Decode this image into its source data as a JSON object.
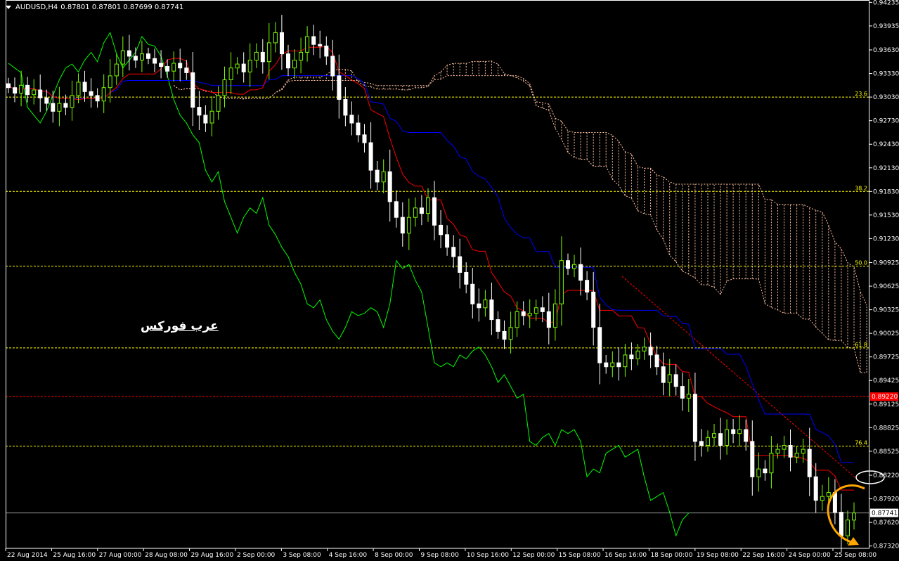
{
  "header": {
    "symbol_label": "AUDUSD,H4",
    "ohlc": "0.87801 0.87801 0.87699 0.87741"
  },
  "watermark": {
    "text": "عرب فوركس"
  },
  "colors": {
    "background": "#000000",
    "axis": "#ffffff",
    "bull_candle": "#7cfc00",
    "bear_candle": "#ffffff",
    "tenkan": "#ff0000",
    "kijun": "#0000ff",
    "chikou": "#00ff00",
    "kumo": "#ffc0a0",
    "fib_level": "#ffff00",
    "alert_line": "#ff0000",
    "annotation_arrow": "#ffa500",
    "annotation_ellipse": "#ffffff"
  },
  "chart_data": {
    "type": "candlestick",
    "symbol": "AUDUSD",
    "timeframe": "H4",
    "ohlc_last": {
      "open": 0.87801,
      "high": 0.87801,
      "low": 0.87699,
      "close": 0.87741
    },
    "price_scale": [
      "0.94235",
      "0.93935",
      "0.93630",
      "0.93330",
      "0.93030",
      "0.92730",
      "0.92430",
      "0.92130",
      "0.91830",
      "0.91530",
      "0.91230",
      "0.90925",
      "0.90625",
      "0.90325",
      "0.90025",
      "0.89725",
      "0.89425",
      "0.89125",
      "0.88825",
      "0.88525",
      "0.88220",
      "0.87920",
      "0.87620",
      "0.87320"
    ],
    "ylim": [
      0.8729,
      0.94265
    ],
    "time_scale": [
      "22 Aug 2014",
      "25 Aug 16:00",
      "27 Aug 00:00",
      "28 Aug 08:00",
      "29 Aug 16:00",
      "2 Sep 00:00",
      "3 Sep 08:00",
      "4 Sep 16:00",
      "8 Sep 00:00",
      "9 Sep 08:00",
      "10 Sep 16:00",
      "12 Sep 00:00",
      "15 Sep 08:00",
      "16 Sep 16:00",
      "18 Sep 00:00",
      "19 Sep 08:00",
      "22 Sep 16:00",
      "24 Sep 00:00",
      "25 Sep 08:00"
    ],
    "fib_levels": [
      {
        "label": "23.6",
        "value": 0.9303
      },
      {
        "label": "38.2",
        "value": 0.9183
      },
      {
        "label": "50.0",
        "value": 0.9088
      },
      {
        "label": "61.8",
        "value": 0.8984
      },
      {
        "label": "76.4",
        "value": 0.8859
      }
    ],
    "alert_line": {
      "label": "0.89220",
      "value": 0.8922
    },
    "current_price": {
      "label": "0.87741",
      "value": 0.87741
    },
    "close_series": [
      0.9315,
      0.9308,
      0.9318,
      0.9306,
      0.9312,
      0.9302,
      0.9295,
      0.9285,
      0.9295,
      0.929,
      0.9305,
      0.9322,
      0.931,
      0.9305,
      0.9298,
      0.9315,
      0.933,
      0.9345,
      0.9362,
      0.9355,
      0.935,
      0.9358,
      0.9352,
      0.9346,
      0.9342,
      0.9336,
      0.9346,
      0.934,
      0.9334,
      0.929,
      0.928,
      0.927,
      0.9285,
      0.9305,
      0.9325,
      0.934,
      0.9345,
      0.9335,
      0.935,
      0.936,
      0.9348,
      0.9372,
      0.9385,
      0.9358,
      0.934,
      0.935,
      0.936,
      0.938,
      0.937,
      0.9368,
      0.9355,
      0.933,
      0.93,
      0.928,
      0.927,
      0.9255,
      0.9245,
      0.921,
      0.9195,
      0.9208,
      0.917,
      0.915,
      0.913,
      0.915,
      0.9162,
      0.9155,
      0.9175,
      0.914,
      0.9128,
      0.9112,
      0.91,
      0.908,
      0.9065,
      0.904,
      0.9035,
      0.9045,
      0.902,
      0.9005,
      0.8995,
      0.901,
      0.903,
      0.9025,
      0.9028,
      0.9035,
      0.903,
      0.901,
      0.904,
      0.9095,
      0.9085,
      0.909,
      0.907,
      0.9055,
      0.901,
      0.8965,
      0.896,
      0.8965,
      0.896,
      0.8975,
      0.897,
      0.898,
      0.8985,
      0.8975,
      0.896,
      0.894,
      0.895,
      0.8935,
      0.892,
      0.8925,
      0.8865,
      0.886,
      0.887,
      0.8875,
      0.886,
      0.888,
      0.8875,
      0.888,
      0.8865,
      0.882,
      0.883,
      0.8825,
      0.885,
      0.8855,
      0.886,
      0.8845,
      0.885,
      0.8855,
      0.882,
      0.879,
      0.8795,
      0.88,
      0.8775,
      0.8745,
      0.8765,
      0.8774
    ]
  }
}
